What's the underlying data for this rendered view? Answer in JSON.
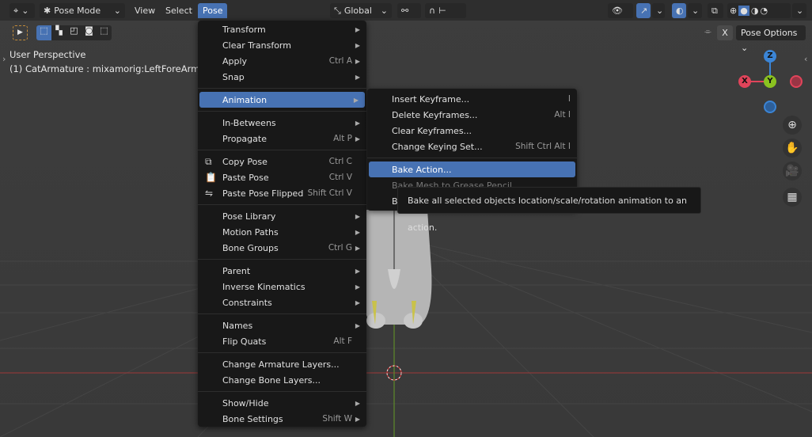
{
  "header": {
    "editor_icon": "object-editor-icon",
    "mode": "Pose Mode",
    "menus": [
      "View",
      "Select",
      "Pose"
    ],
    "orientation": "Global",
    "pose_options": "Pose Options",
    "mirror_x": "X"
  },
  "overlay": {
    "perspective": "User Perspective",
    "object": "(1) CatArmature : mixamorig:LeftForeArm"
  },
  "gizmo": {
    "z": "Z",
    "x": "X",
    "y": "Y",
    "colors": {
      "x": "#e0445a",
      "y": "#8bc220",
      "z": "#3b85d6"
    }
  },
  "pose_menu": [
    [
      {
        "label": "Transform",
        "arrow": true
      },
      {
        "label": "Clear Transform",
        "arrow": true
      },
      {
        "label": "Apply",
        "shortcut": "Ctrl A",
        "arrow": true
      },
      {
        "label": "Snap",
        "arrow": true
      }
    ],
    [
      {
        "label": "Animation",
        "arrow": true,
        "highlight": true
      }
    ],
    [
      {
        "label": "In-Betweens",
        "arrow": true
      },
      {
        "label": "Propagate",
        "shortcut": "Alt P",
        "arrow": true
      }
    ],
    [
      {
        "label": "Copy Pose",
        "shortcut": "Ctrl C",
        "icon": "copy-icon"
      },
      {
        "label": "Paste Pose",
        "shortcut": "Ctrl V",
        "icon": "paste-icon"
      },
      {
        "label": "Paste Pose Flipped",
        "shortcut": "Shift Ctrl V",
        "icon": "paste-flipped-icon"
      }
    ],
    [
      {
        "label": "Pose Library",
        "arrow": true
      },
      {
        "label": "Motion Paths",
        "arrow": true
      },
      {
        "label": "Bone Groups",
        "shortcut": "Ctrl G",
        "arrow": true
      }
    ],
    [
      {
        "label": "Parent",
        "arrow": true
      },
      {
        "label": "Inverse Kinematics",
        "arrow": true
      },
      {
        "label": "Constraints",
        "arrow": true
      }
    ],
    [
      {
        "label": "Names",
        "arrow": true
      },
      {
        "label": "Flip Quats",
        "shortcut": "Alt F"
      }
    ],
    [
      {
        "label": "Change Armature Layers..."
      },
      {
        "label": "Change Bone Layers..."
      }
    ],
    [
      {
        "label": "Show/Hide",
        "arrow": true
      },
      {
        "label": "Bone Settings",
        "shortcut": "Shift W",
        "arrow": true
      }
    ]
  ],
  "animation_menu": [
    [
      {
        "label": "Insert Keyframe...",
        "shortcut": "I"
      },
      {
        "label": "Delete Keyframes...",
        "shortcut": "Alt I"
      },
      {
        "label": "Clear Keyframes..."
      },
      {
        "label": "Change Keying Set...",
        "shortcut": "Shift Ctrl Alt I"
      }
    ],
    [
      {
        "label": "Bake Action...",
        "highlight": true
      },
      {
        "label": "Bake Mesh to Grease Pencil",
        "dim": true
      },
      {
        "label": "B"
      }
    ]
  ],
  "tooltip": "Bake all selected objects location/scale/rotation animation to an action."
}
